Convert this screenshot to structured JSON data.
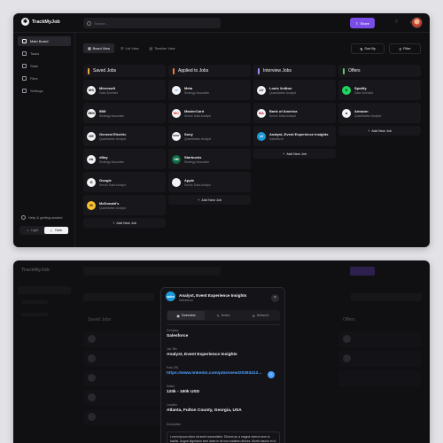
{
  "app": {
    "name": "TrackMyJob",
    "logo_glyph": "✱"
  },
  "search": {
    "placeholder": "Search..."
  },
  "header": {
    "share_label": "Share"
  },
  "sidebar": {
    "items": [
      {
        "label": "Main Board",
        "icon": "board-icon"
      },
      {
        "label": "Tasks",
        "icon": "tasks-icon"
      },
      {
        "label": "Stats",
        "icon": "stats-icon"
      },
      {
        "label": "Files",
        "icon": "files-icon"
      },
      {
        "label": "Settings",
        "icon": "settings-icon"
      }
    ],
    "help_label": "Help & getting started",
    "theme": {
      "light": "Light",
      "dark": "Dark"
    }
  },
  "toolbar": {
    "views": [
      "Board View",
      "List View",
      "Timeline View"
    ],
    "sort_label": "Sort By",
    "filter_label": "Filter"
  },
  "board": {
    "add_label": "Add New Job",
    "columns": [
      {
        "title": "Saved Jobs",
        "color": "#f0a545",
        "jobs": [
          {
            "company": "Microsoft",
            "role": "Data Scientist",
            "logo": "MS"
          },
          {
            "company": "IBM",
            "role": "Strategy Associate",
            "logo": "IBM"
          },
          {
            "company": "General Electric",
            "role": "Quantitative Analyst",
            "logo": "GE"
          },
          {
            "company": "eBay",
            "role": "Strategy Associate",
            "logo": "eb"
          },
          {
            "company": "Google",
            "role": "Senior Data Analyst",
            "logo": "G"
          },
          {
            "company": "McDonald's",
            "role": "Quantitative Analyst",
            "logo": "M"
          }
        ]
      },
      {
        "title": "Applied to Jobs",
        "color": "#f07a3c",
        "jobs": [
          {
            "company": "Meta",
            "role": "Strategy Associate",
            "logo": "∞"
          },
          {
            "company": "MasterCard",
            "role": "Senior Data Analyst",
            "logo": "MC"
          },
          {
            "company": "Sony",
            "role": "Quantitative Analyst",
            "logo": "SONY"
          },
          {
            "company": "Starbucks",
            "role": "Strategy Associate",
            "logo": "SB"
          },
          {
            "company": "Apple",
            "role": "Senior Data Analyst",
            "logo": ""
          }
        ]
      },
      {
        "title": "Interview Jobs",
        "color": "#a98cf0",
        "jobs": [
          {
            "company": "Louis Vuitton",
            "role": "Quantitative Analyst",
            "logo": "LV"
          },
          {
            "company": "Bank of America",
            "role": "Senior Data Analyst",
            "logo": "BA"
          },
          {
            "company": "Analyst, Event Experience Insights",
            "role": "Salesforce",
            "logo": "sf"
          }
        ]
      },
      {
        "title": "Offers",
        "color": "#5cc96a",
        "jobs": [
          {
            "company": "Spotify",
            "role": "Data Scientist",
            "logo": "S"
          },
          {
            "company": "Amazon",
            "role": "Quantitative Analyst",
            "logo": "a"
          }
        ]
      }
    ]
  },
  "modal": {
    "title": "Analyst, Event Experience Insights",
    "company_short": "Salesforce",
    "logo": "sales",
    "tabs": [
      "Overview",
      "Notes",
      "Network"
    ],
    "fields": {
      "company_label": "Company",
      "company": "Salesforce",
      "title_label": "Job Title",
      "title": "Analyst, Event Experience Insights",
      "url_label": "Post URL",
      "url": "https://www.linkedin.com/jobs/view/20393412...",
      "salary_label": "Salary",
      "salary": "120k - 160k USD",
      "location_label": "Location",
      "location": "Atlanta, Fulton County, Georgia, USA",
      "desc_label": "Description",
      "desc": "Lorem ipsum dolor sit amet consectetur. Dictum ac a magna viverra sem ut facilisi. Augue dignissim sem diam in sit non sodales ultrices. Morbi mauris et ut mauris. Dignissim leo tempor fermentum amet."
    }
  },
  "dim": {
    "title": "TrackMyJob",
    "col1": "Saved Jobs",
    "col4": "Offers"
  }
}
